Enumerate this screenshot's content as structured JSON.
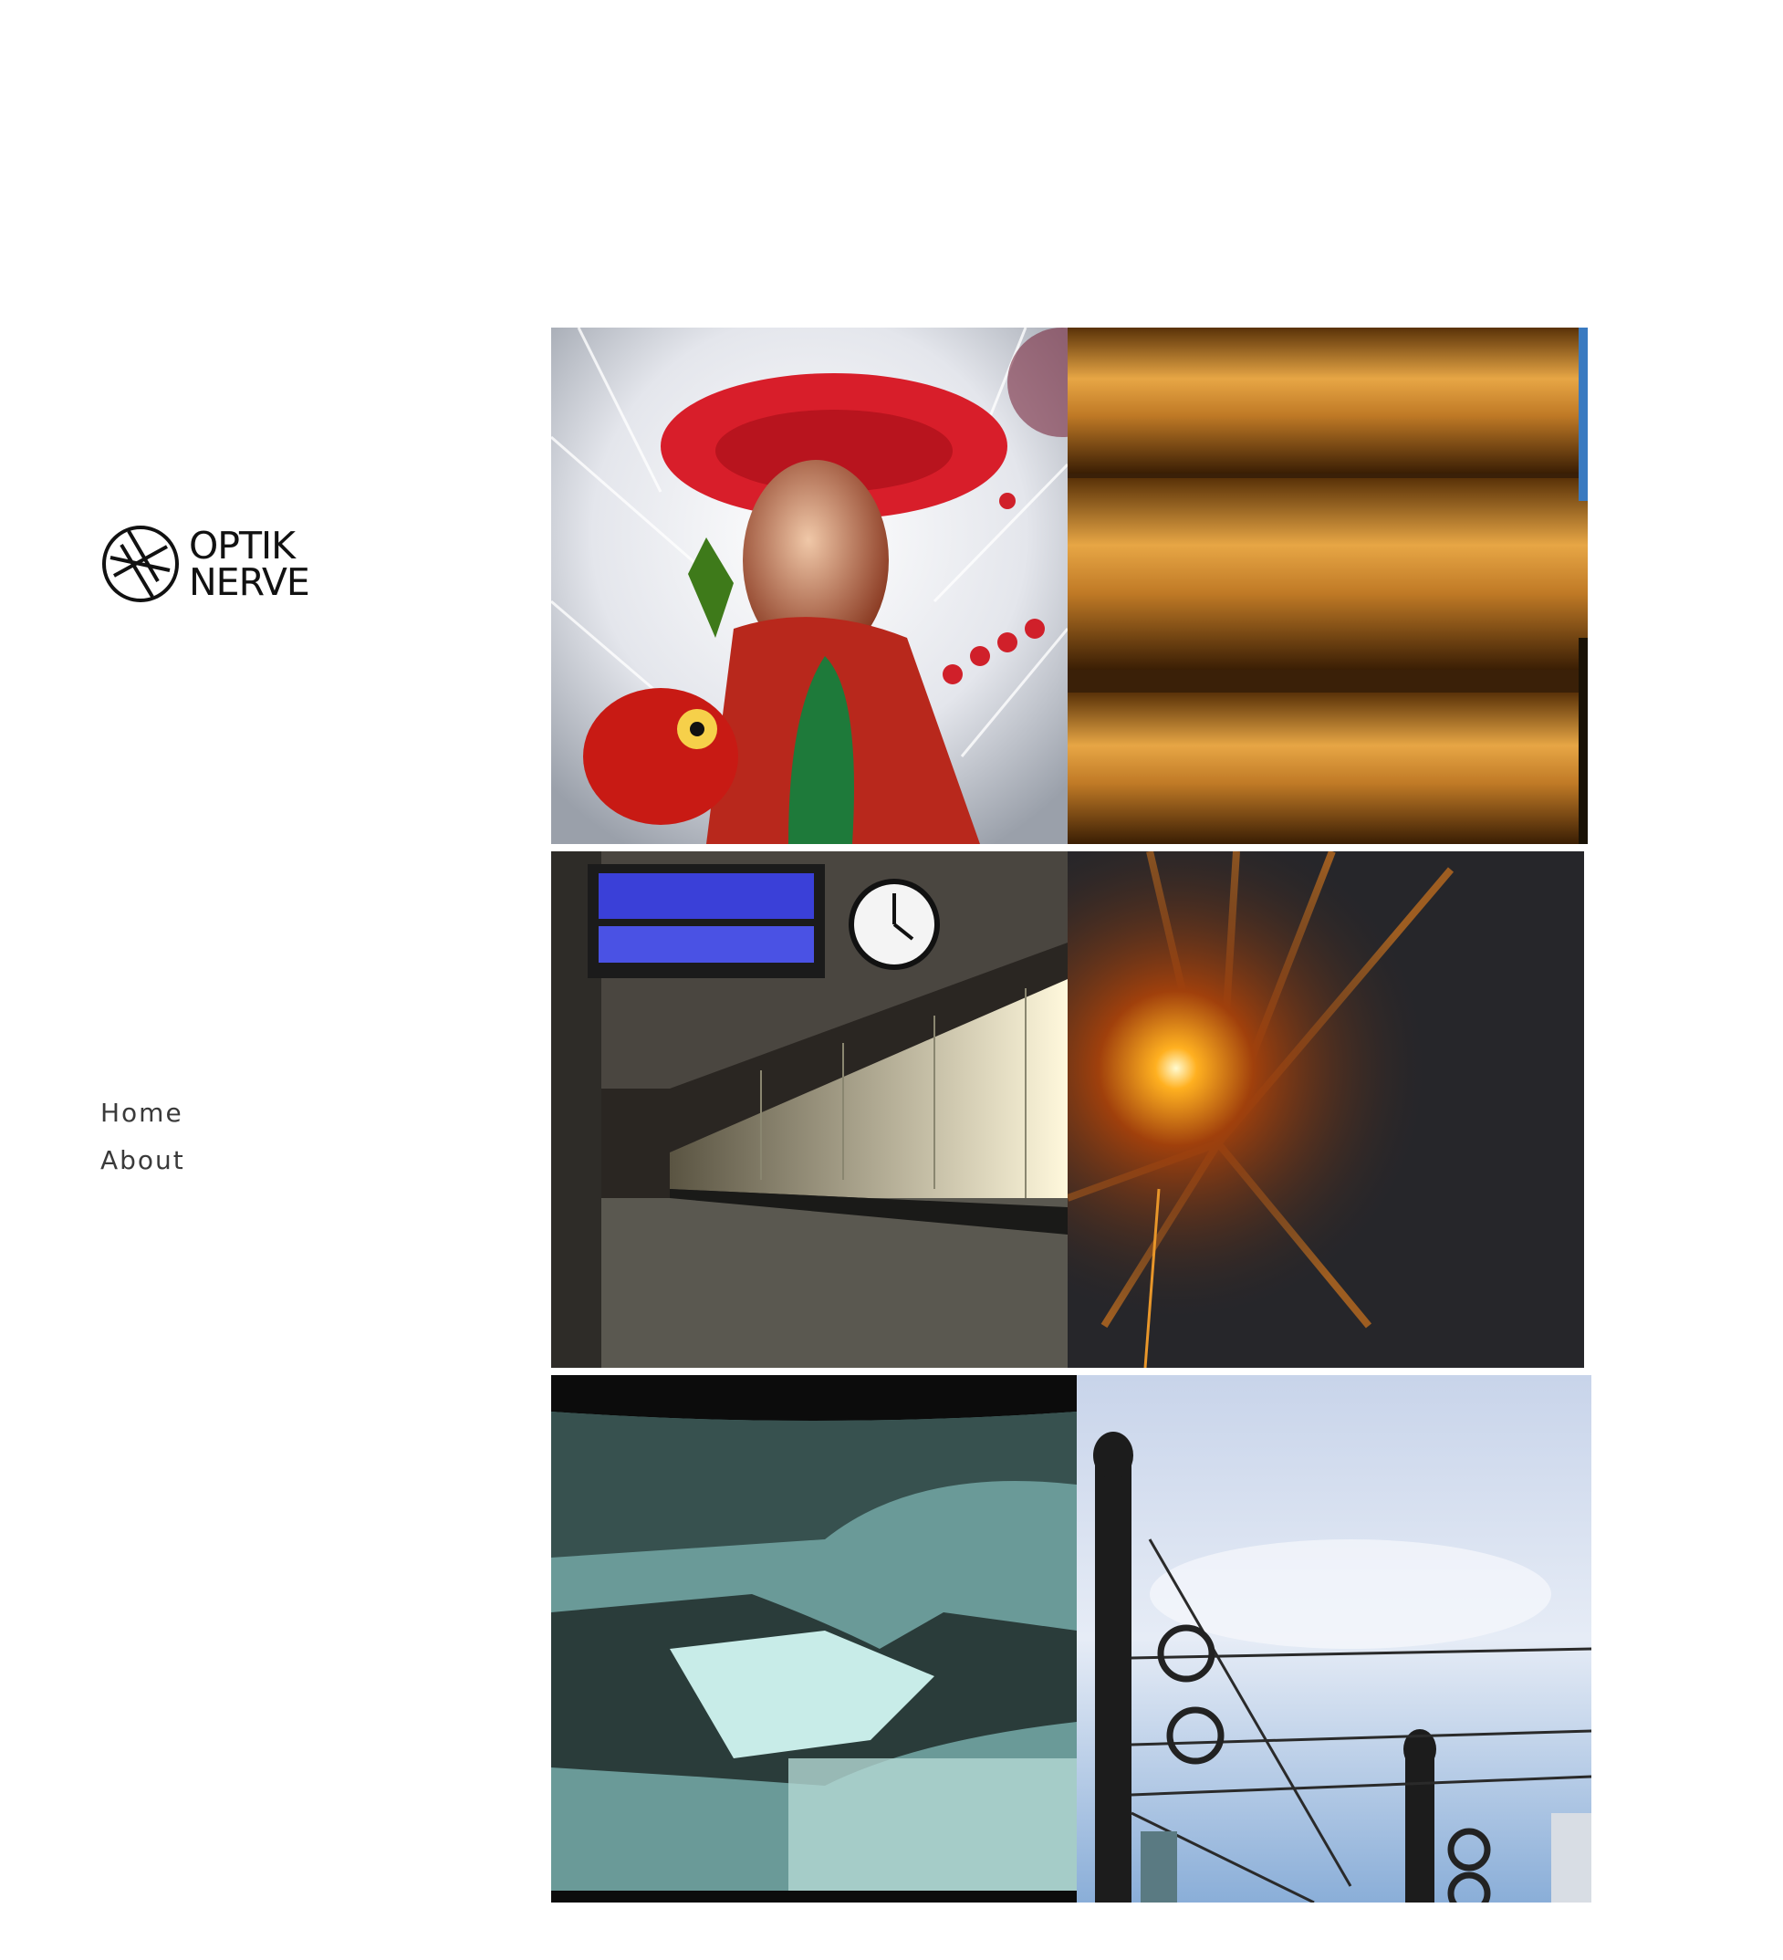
{
  "site": {
    "logo_line1": "OPTIK",
    "logo_line2": "NERVE"
  },
  "nav": {
    "items": [
      {
        "label": "Home"
      },
      {
        "label": "About"
      }
    ]
  },
  "gallery": {
    "photos": [
      {
        "subject": "christmas-ornament",
        "colors": [
          "#c8202a",
          "#eeeeee",
          "#1e7a3a"
        ]
      },
      {
        "subject": "copper-pipes",
        "colors": [
          "#9b5a14",
          "#e0a040",
          "#3a2008"
        ]
      },
      {
        "subject": "train-platform",
        "colors": [
          "#1a1816",
          "#3b3ee0",
          "#f5f0d8"
        ]
      },
      {
        "subject": "street-lamp-night",
        "colors": [
          "#2a2a2e",
          "#ff9a10",
          "#fff4a0"
        ]
      },
      {
        "subject": "projected-screen",
        "colors": [
          "#0c0c0c",
          "#5f8f8c",
          "#b4d8d4"
        ]
      },
      {
        "subject": "overhead-wires-sky",
        "colors": [
          "#b8c8e0",
          "#1c1c1c",
          "#e8eef6"
        ]
      }
    ]
  }
}
